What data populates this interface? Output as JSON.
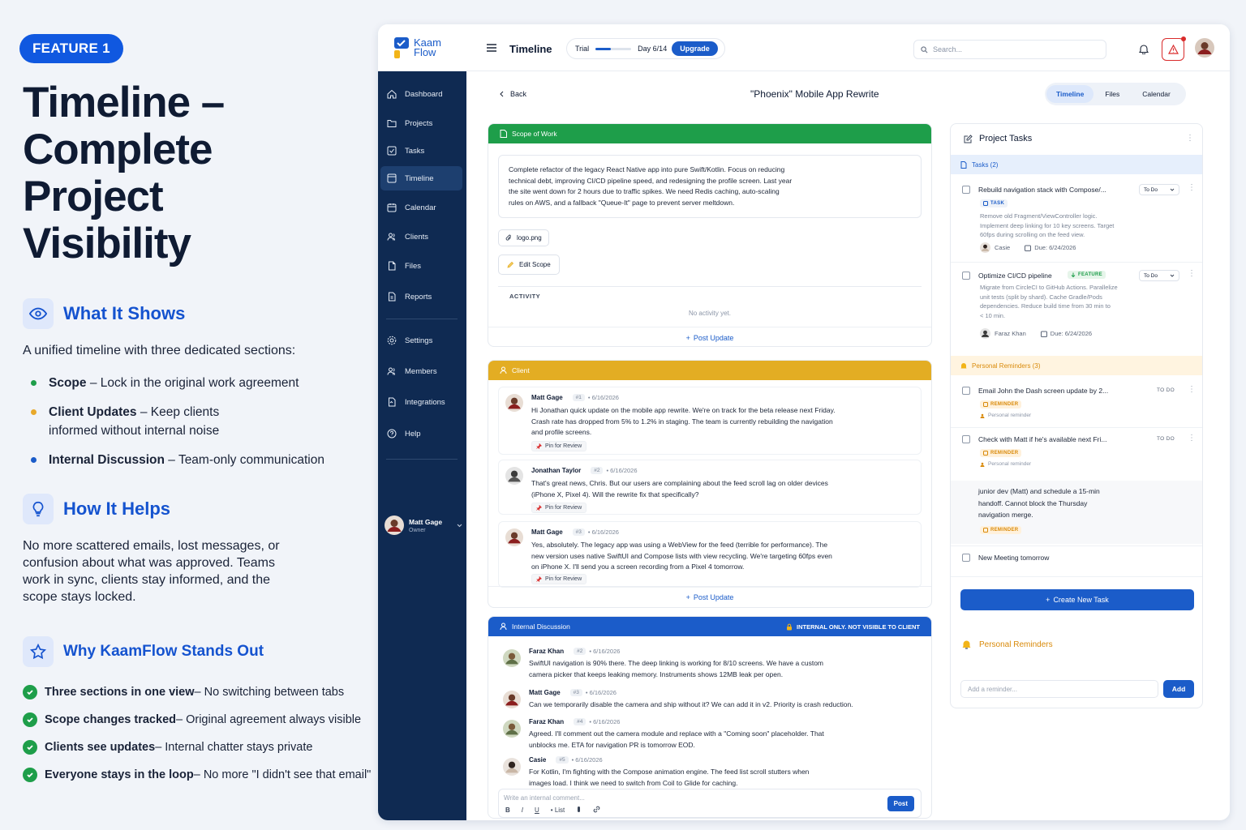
{
  "left": {
    "badge": "FEATURE 1",
    "title_l1": "Timeline –",
    "title_l2": "Complete Project",
    "title_l3": "Visibility",
    "what_title": "What It Shows",
    "what_intro": "A unified timeline with three dedicated sections:",
    "sections": [
      {
        "name": "Scope",
        "desc": " – Lock in the original work agreement",
        "color": "#1e9e4a"
      },
      {
        "name": "Client Updates",
        "desc": " – Keep clients informed without internal noise",
        "color": "#e8a92b"
      },
      {
        "name": "Internal Discussion",
        "desc": " – Team-only communication",
        "color": "#1b5cc9"
      }
    ],
    "how_title": "How It Helps",
    "how_text": "No more scattered emails, lost messages, or confusion about what was approved. Teams work in sync, clients stay informed, and the scope stays locked.",
    "why_title": "Why KaamFlow Stands Out",
    "why": [
      {
        "name": "Three sections in one view",
        "desc": " – No switching between tabs"
      },
      {
        "name": "Scope changes tracked",
        "desc": " – Original agreement always visible"
      },
      {
        "name": "Clients see updates",
        "desc": " – Internal chatter stays private"
      },
      {
        "name": "Everyone stays in the loop",
        "desc": " – No more \"I didn't see that email\""
      }
    ]
  },
  "topbar": {
    "logo_l1": "Kaam",
    "logo_l2": "Flow",
    "page": "Timeline",
    "trial_label": "Trial",
    "trial_progress": 0.43,
    "trial_day": "Day 6/14",
    "upgrade": "Upgrade",
    "search_placeholder": "Search..."
  },
  "sidebar": {
    "items": [
      "Dashboard",
      "Projects",
      "Tasks",
      "Timeline",
      "Calendar",
      "Clients",
      "Files",
      "Reports",
      "Settings",
      "Members",
      "Integrations",
      "Help"
    ],
    "active": "Timeline",
    "user_name": "Matt Gage",
    "user_role": "Owner"
  },
  "header": {
    "back": "Back",
    "project": "\"Phoenix\" Mobile App Rewrite",
    "tabs": [
      "Timeline",
      "Files",
      "Calendar"
    ]
  },
  "scope": {
    "title": "Scope of Work",
    "text_l1": "Complete refactor of the legacy React Native app into pure Swift/Kotlin. Focus on reducing",
    "text_l2": "technical debt, improving CI/CD pipeline speed, and redesigning the profile screen. Last year",
    "text_l3": "the site went down for 2 hours due to traffic spikes. We need Redis caching, auto-scaling",
    "text_l4": "rules on AWS, and a fallback \"Queue-It\" page to prevent server meltdown.",
    "attachment": "logo.png",
    "edit": "Edit Scope",
    "activity": "ACTIVITY",
    "no_activity": "No activity yet.",
    "post_update": "Post Update",
    "color": "#1e9e4a"
  },
  "client": {
    "title": "Client",
    "color": "#e3ad23",
    "pin": "Pin for Review",
    "post_update": "Post Update",
    "messages": [
      {
        "author": "Matt Gage",
        "num": "#1",
        "date": "• 6/16/2026",
        "l1": "Hi Jonathan quick update on the mobile app rewrite. We're on track for the beta release next Friday.",
        "l2": "Crash rate has dropped from 5% to 1.2% in staging. The team is currently rebuilding the navigation",
        "l3": "and profile screens."
      },
      {
        "author": "Jonathan Taylor",
        "num": "#2",
        "date": "• 6/16/2026",
        "l1": "That's great news, Chris. But our users are complaining about the feed scroll lag on older devices",
        "l2": "(iPhone X, Pixel 4). Will the rewrite fix that specifically?",
        "l3": ""
      },
      {
        "author": "Matt Gage",
        "num": "#3",
        "date": "• 6/16/2026",
        "l1": "Yes, absolutely. The legacy app was using a WebView for the feed (terrible for performance). The",
        "l2": "new version uses native SwiftUI and Compose lists with view recycling. We're targeting 60fps even",
        "l3": "on iPhone X. I'll send you a screen recording from a Pixel 4 tomorrow."
      }
    ]
  },
  "internal": {
    "title": "Internal Discussion",
    "notice": "INTERNAL ONLY. NOT VISIBLE TO CLIENT",
    "color": "#1b5cc9",
    "messages": [
      {
        "author": "Faraz Khan",
        "num": "#2",
        "date": "• 6/16/2026",
        "l1": "SwiftUI navigation is 90% there. The deep linking is working for 8/10 screens. We have a custom",
        "l2": "camera picker that keeps leaking memory. Instruments shows 12MB leak per open."
      },
      {
        "author": "Matt Gage",
        "num": "#3",
        "date": "• 6/16/2026",
        "l1": "Can we temporarily disable the camera and ship without it? We can add it in v2. Priority is crash reduction.",
        "l2": ""
      },
      {
        "author": "Faraz Khan",
        "num": "#4",
        "date": "• 6/16/2026",
        "l1": "Agreed. I'll comment out the camera module and replace with a \"Coming soon\" placeholder. That",
        "l2": "unblocks me. ETA for navigation PR is tomorrow EOD."
      },
      {
        "author": "Casie",
        "num": "#5",
        "date": "• 6/16/2026",
        "l1": "For Kotlin, I'm fighting with the Compose animation engine. The feed list scroll stutters when",
        "l2": "images load. I think we need to switch from Coil to Glide for caching."
      }
    ],
    "composer_placeholder": "Write an internal comment...",
    "tool_b": "B",
    "tool_i": "I",
    "tool_u": "U",
    "tool_list": "• List",
    "post": "Post"
  },
  "tasks": {
    "title": "Project Tasks",
    "tasks_band": "Tasks (2)",
    "items": [
      {
        "title": "Rebuild navigation stack with Compose/...",
        "status": "To Do",
        "tag": "TASK",
        "d1": "Remove old Fragment/ViewController logic.",
        "d2": "Implement deep linking for 10 key screens. Target",
        "d3": "60fps during scrolling on the feed view.",
        "d4": "",
        "assignee": "Casie",
        "due": "Due: 6/24/2026"
      },
      {
        "title": "Optimize CI/CD pipeline",
        "status": "To Do",
        "tag": "FEATURE",
        "d1": "Migrate from CircleCI to GitHub Actions. Parallelize",
        "d2": "unit tests (split by shard). Cache Gradle/Pods",
        "d3": "dependencies. Reduce build time from 30 min to",
        "d4": "< 10 min.",
        "assignee": "Faraz Khan",
        "due": "Due: 6/24/2026"
      }
    ],
    "reminders_band": "Personal Reminders (3)",
    "reminders": [
      {
        "title": "Email John the Dash screen update by 2...",
        "status": "TO DO",
        "tag": "REMINDER",
        "sub": "Personal reminder"
      },
      {
        "title": "Check with Matt if he's available next Fri...",
        "status": "TO DO",
        "tag": "REMINDER",
        "sub": "Personal reminder"
      }
    ],
    "expanded_l1": "junior dev (Matt) and schedule a 15-min",
    "expanded_l2": "handoff. Cannot block the Thursday",
    "expanded_l3": "navigation merge.",
    "expanded_tag": "REMINDER",
    "meeting": "New Meeting tomorrow",
    "create": "Create New Task",
    "pr_title": "Personal Reminders",
    "reminder_placeholder": "Add a reminder...",
    "add": "Add"
  }
}
